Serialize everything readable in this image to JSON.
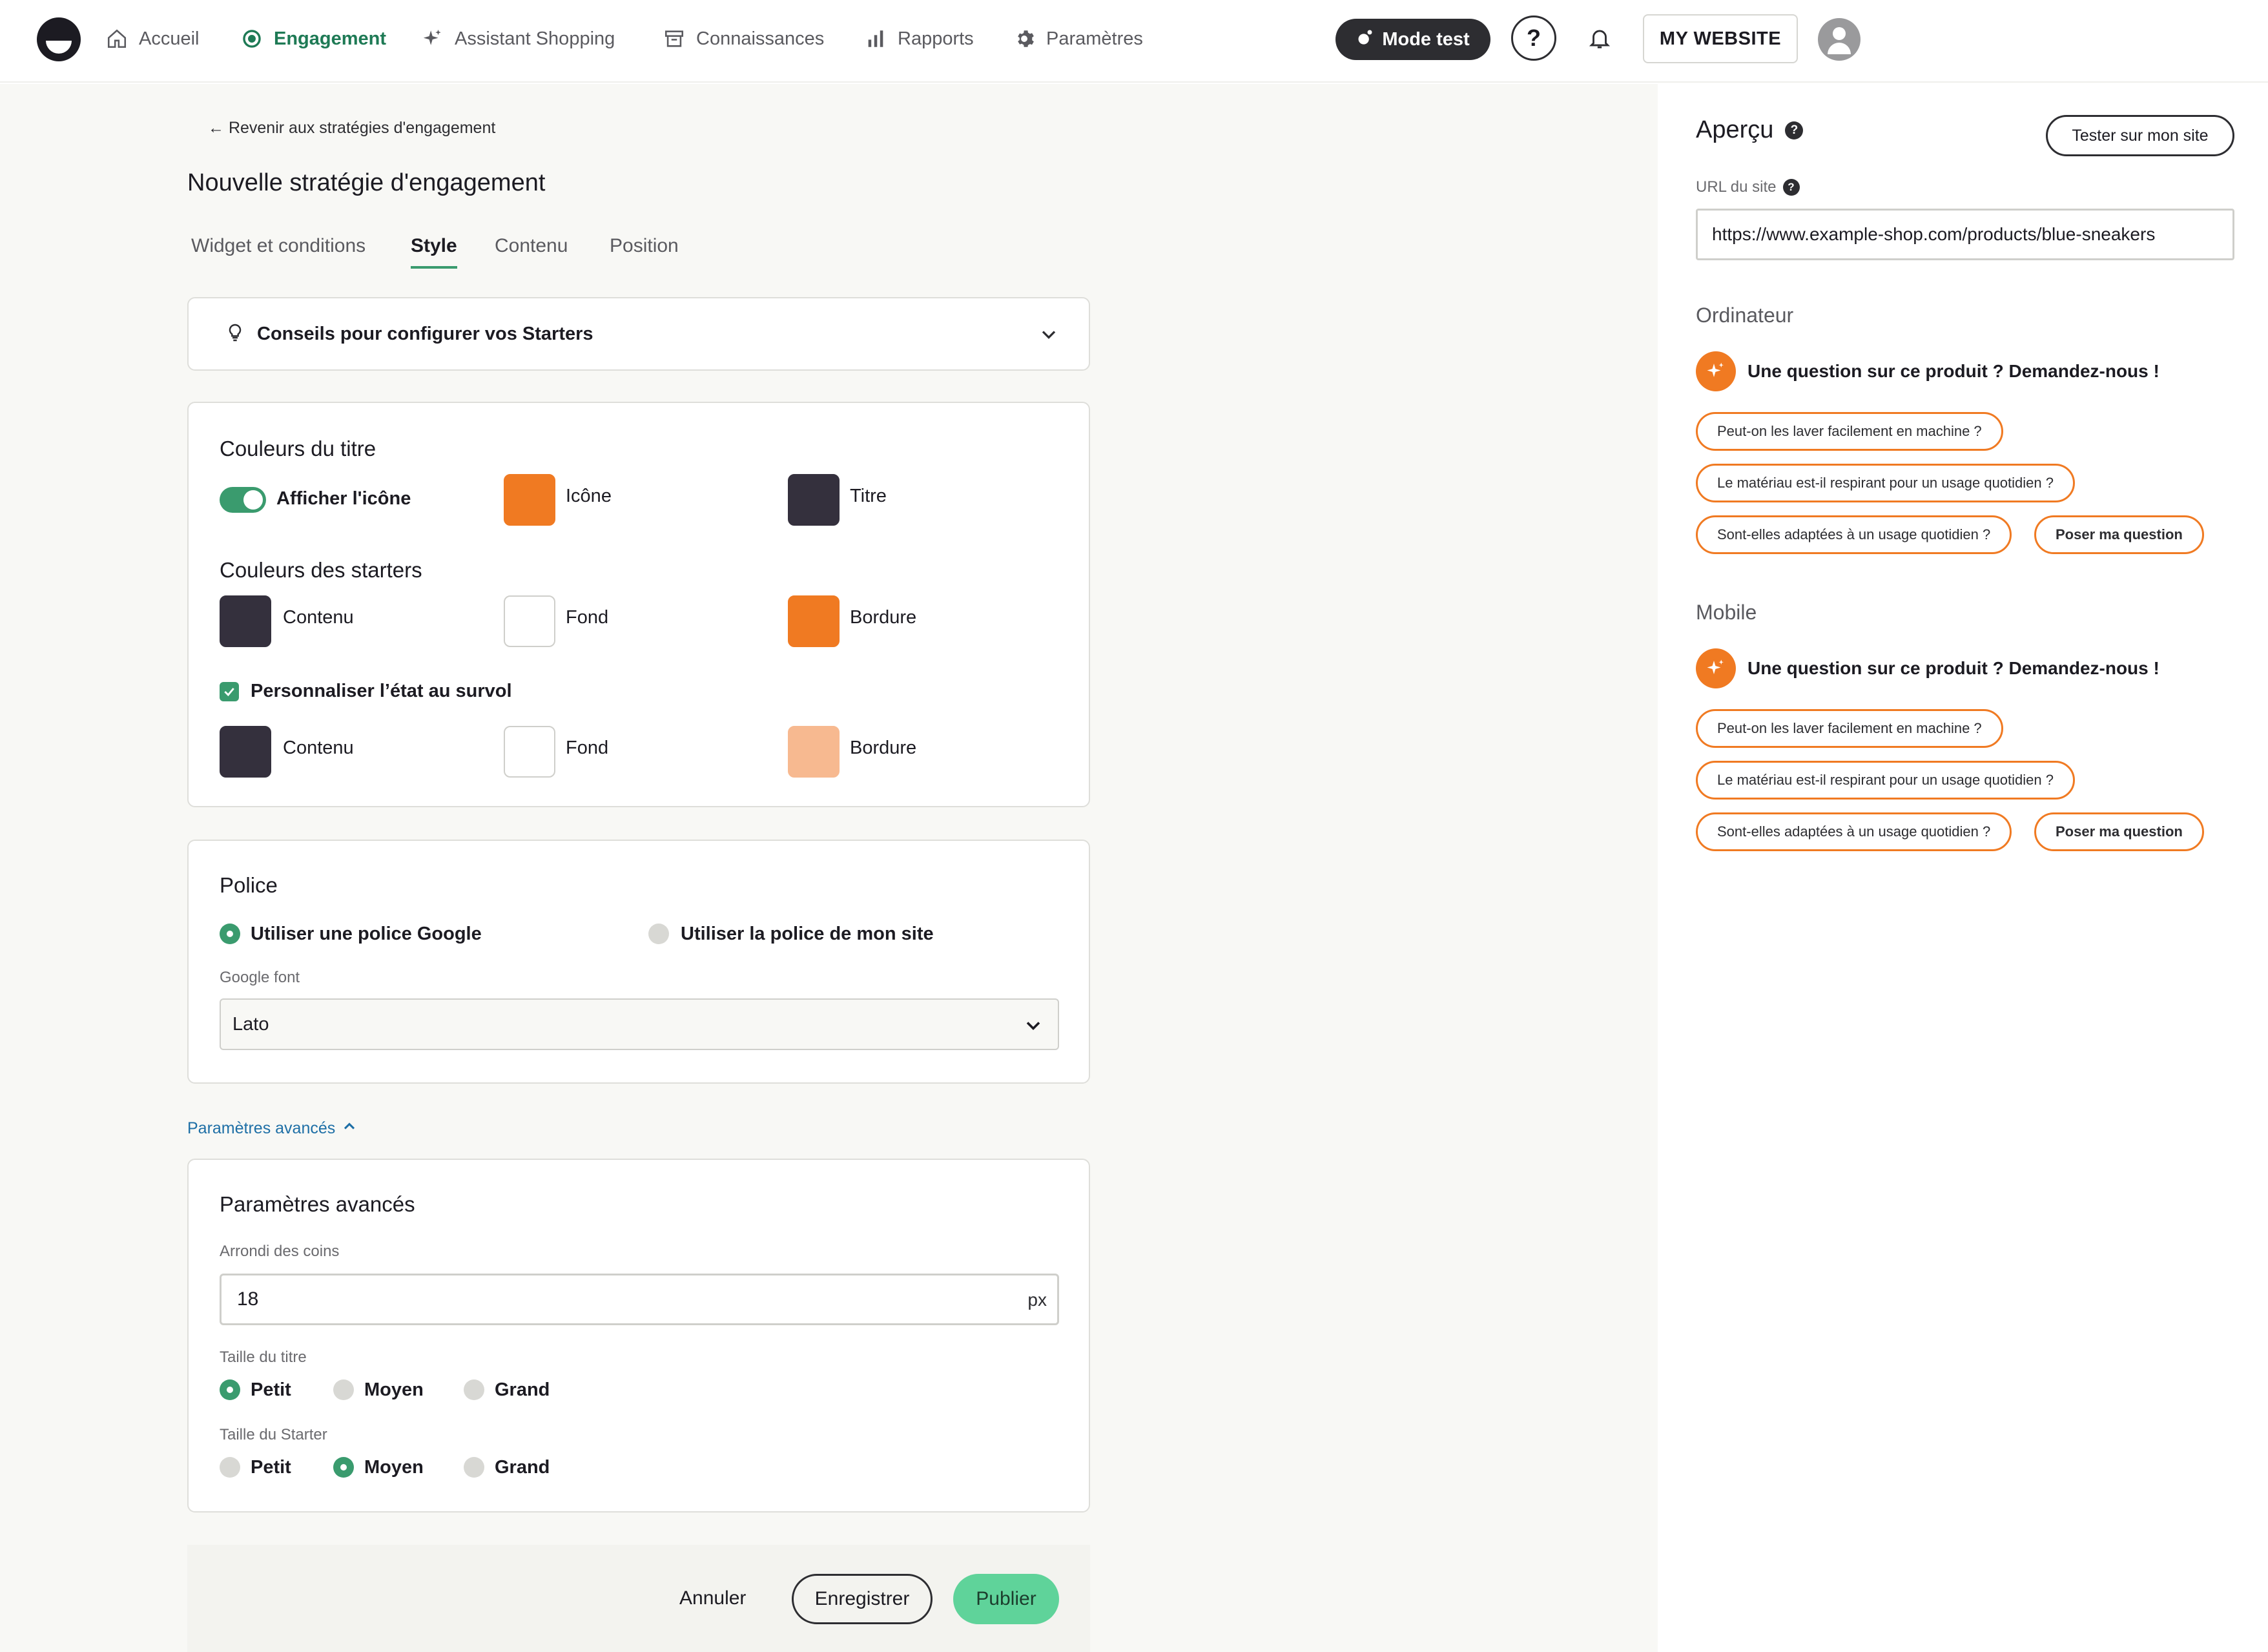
{
  "nav": {
    "items": [
      {
        "label": "Accueil",
        "icon": "home-icon",
        "active": false
      },
      {
        "label": "Engagement",
        "icon": "target-icon",
        "active": true
      },
      {
        "label": "Assistant Shopping",
        "icon": "sparkle-icon",
        "active": false
      },
      {
        "label": "Connaissances",
        "icon": "archive-icon",
        "active": false
      },
      {
        "label": "Rapports",
        "icon": "bar-chart-icon",
        "active": false
      },
      {
        "label": "Paramètres",
        "icon": "gear-icon",
        "active": false
      }
    ],
    "mode_test": "Mode test",
    "help": "?",
    "website": "MY WEBSITE"
  },
  "page": {
    "back_link": "← Revenir aux stratégies d'engagement",
    "title": "Nouvelle stratégie d'engagement",
    "tabs": [
      {
        "label": "Widget et conditions",
        "active": false
      },
      {
        "label": "Style",
        "active": true
      },
      {
        "label": "Contenu",
        "active": false
      },
      {
        "label": "Position",
        "active": false
      }
    ]
  },
  "tips": {
    "label": "Conseils pour configurer vos Starters"
  },
  "colors": {
    "title_section": "Couleurs du titre",
    "show_icon_label": "Afficher l'icône",
    "show_icon_on": true,
    "icon_label": "Icône",
    "icon_color": "#f07a22",
    "title_label": "Titre",
    "title_color": "#34303d",
    "starters_section": "Couleurs des starters",
    "content_label": "Contenu",
    "content_color": "#34303d",
    "background_label": "Fond",
    "background_color": "#ffffff",
    "border_label": "Bordure",
    "border_color": "#f07a22",
    "hover_label": "Personnaliser l’état au survol",
    "hover_checked": true,
    "hover_content_label": "Contenu",
    "hover_content_color": "#34303d",
    "hover_background_label": "Fond",
    "hover_background_color": "#ffffff",
    "hover_border_label": "Bordure",
    "hover_border_color": "#f7b990"
  },
  "font": {
    "section": "Police",
    "option_google": "Utiliser une police Google",
    "option_site": "Utiliser la police de mon site",
    "selected": "google",
    "google_font_label": "Google font",
    "google_font_value": "Lato"
  },
  "advanced": {
    "link": "Paramètres avancés",
    "section": "Paramètres avancés",
    "radius_label": "Arrondi des coins",
    "radius_value": "18",
    "radius_unit": "px",
    "title_size_label": "Taille du titre",
    "starter_size_label": "Taille du Starter",
    "sizes": [
      "Petit",
      "Moyen",
      "Grand"
    ],
    "title_size_selected": "Petit",
    "starter_size_selected": "Moyen"
  },
  "footer": {
    "cancel": "Annuler",
    "save": "Enregistrer",
    "publish": "Publier"
  },
  "preview": {
    "title": "Aperçu",
    "help": "?",
    "test_button": "Tester sur mon site",
    "url_label": "URL du site",
    "url_value": "https://www.example-shop.com/products/blue-sneakers",
    "desktop_label": "Ordinateur",
    "mobile_label": "Mobile",
    "headline": "Une question sur ce produit ? Demandez-nous !",
    "chips": [
      "Peut-on les laver facilement en machine ?",
      "Le matériau est-il respirant pour un usage quotidien ?",
      "Sont-elles adaptées à un usage quotidien ?"
    ],
    "ask_button": "Poser ma question"
  }
}
